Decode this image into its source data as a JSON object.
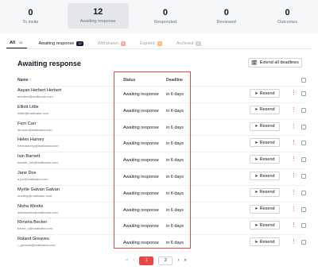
{
  "stats": [
    {
      "num": "0",
      "label": "To invite"
    },
    {
      "num": "12",
      "label": "Awaiting response"
    },
    {
      "num": "0",
      "label": "Responded"
    },
    {
      "num": "0",
      "label": "Reviewed"
    },
    {
      "num": "0",
      "label": "Outcomes"
    }
  ],
  "tabs": [
    {
      "label": "All",
      "count": "12"
    },
    {
      "label": "Awaiting response",
      "count": "12"
    },
    {
      "label": "Withdrawn",
      "count": "0"
    },
    {
      "label": "Expired",
      "count": "0"
    },
    {
      "label": "Archived",
      "count": "0"
    }
  ],
  "section_title": "Awaiting response",
  "extend_label": "Extend all deadlines",
  "columns": {
    "name": "Name ↑",
    "status": "Status",
    "deadline": "Deadline"
  },
  "resend_label": "Resend",
  "rows": [
    {
      "name": "Aayan Herbert Herbert",
      "email": "aherbert@mailinator.com",
      "status": "Awaiting response",
      "deadline": "in 6 days"
    },
    {
      "name": "Elliott Little",
      "email": "elittle@mailinator.com",
      "status": "Awaiting response",
      "deadline": "in 6 days"
    },
    {
      "name": "Fern Carr",
      "email": "ferncarr@mailinator.com",
      "status": "Awaiting response",
      "deadline": "in 6 days"
    },
    {
      "name": "Helen Harvey",
      "email": "helenharvey@mailinator.com",
      "status": "Awaiting response",
      "deadline": "in 6 days"
    },
    {
      "name": "Iain Barnett",
      "email": "barnett_iain@mailinator.com",
      "status": "Awaiting response",
      "deadline": "in 6 days"
    },
    {
      "name": "Jane Doe",
      "email": "d.jue@mailinator.com",
      "status": "Awaiting response",
      "deadline": "in 6 days"
    },
    {
      "name": "Myrtle Galvan Galvan",
      "email": "mortleg@mailinator.com",
      "status": "Awaiting response",
      "deadline": "in 6 days"
    },
    {
      "name": "Nisha Weeks",
      "email": "nishaweeks@mailinator.com",
      "status": "Awaiting response",
      "deadline": "in 6 days"
    },
    {
      "name": "Rimsha Becker",
      "email": "becke_r@mailinator.com",
      "status": "Awaiting response",
      "deadline": "in 6 days"
    },
    {
      "name": "Roland Greaves",
      "email": "r_greaves@mailinator.com",
      "status": "Awaiting response",
      "deadline": "in 6 days"
    }
  ],
  "pagination": {
    "pages": [
      "1",
      "2"
    ],
    "current": "1"
  },
  "colors": {
    "accent": "#ef4444",
    "more": "#dc2626"
  }
}
